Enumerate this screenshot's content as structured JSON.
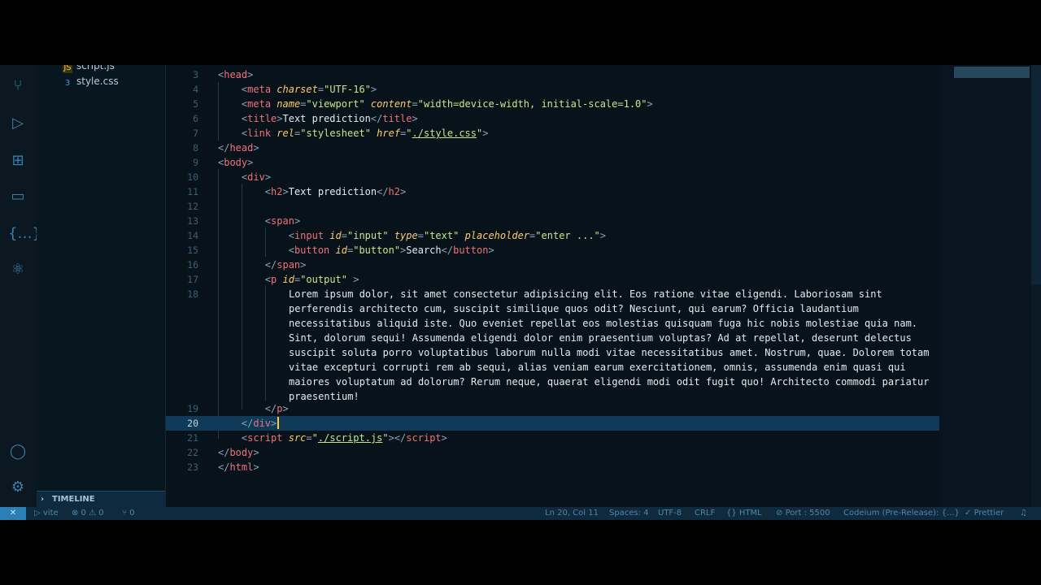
{
  "explorer": {
    "files": [
      {
        "name": "script.js",
        "icon": "js-file-icon",
        "color": "#e8c846"
      },
      {
        "name": "style.css",
        "icon": "css-file-icon",
        "color": "#3b9ad8"
      }
    ],
    "timeline_label": "TIMELINE"
  },
  "editor": {
    "current_line": "20",
    "lines": [
      {
        "n": "3"
      },
      {
        "n": "4",
        "value": "UTF-16"
      },
      {
        "n": "5",
        "name": "viewport",
        "content": "width=device-width, initial-scale=1.0"
      },
      {
        "n": "6",
        "text": "Text prediction"
      },
      {
        "n": "7",
        "rel": "stylesheet",
        "href": "./style.css"
      },
      {
        "n": "8"
      },
      {
        "n": "9"
      },
      {
        "n": "10"
      },
      {
        "n": "11",
        "text": "Text prediction"
      },
      {
        "n": "12"
      },
      {
        "n": "13"
      },
      {
        "n": "14",
        "id": "input",
        "type": "text",
        "placeholder": "enter ..."
      },
      {
        "n": "15",
        "id": "button",
        "text": "Search"
      },
      {
        "n": "16"
      },
      {
        "n": "17",
        "id": "output"
      },
      {
        "n": "18",
        "paragraph": [
          "Lorem ipsum dolor, sit amet consectetur adipisicing elit. Eos ratione vitae eligendi. Laboriosam sint",
          "perferendis architecto cum, suscipit similique quos odit? Nesciunt, qui earum? Officia laudantium",
          "necessitatibus aliquid iste. Quo eveniet repellat eos molestias quisquam fuga hic nobis molestiae quia nam.",
          "Sint, dolorum sequi! Assumenda eligendi dolor enim praesentium voluptas? Ad at repellat, deserunt delectus",
          "suscipit soluta porro voluptatibus laborum nulla modi vitae necessitatibus amet. Nostrum, quae. Dolorem totam",
          "vitae excepturi corrupti rem ab sequi, alias veniam earum exercitationem, omnis, assumenda enim quasi qui",
          "maiores voluptatum ad dolorum? Rerum neque, quaerat eligendi modi odit fugit quo! Architecto commodi pariatur",
          "praesentium!"
        ]
      },
      {
        "n": "19"
      },
      {
        "n": "20"
      },
      {
        "n": "21",
        "src": "./script.js"
      },
      {
        "n": "22"
      },
      {
        "n": "23"
      }
    ]
  },
  "statusbar": {
    "branch": "vite",
    "problems": "⊗ 0 ⚠ 0",
    "ports": "0",
    "position": "Ln 20, Col 11",
    "spaces": "Spaces: 4",
    "encoding": "UTF-8",
    "eol": "CRLF",
    "language": "HTML",
    "port": "Port : 5500",
    "ai": "Codeium (Pre-Release): {...}",
    "formatter": "Prettier"
  },
  "colors": {
    "tag": "#f07178",
    "attribute": "#ffcb6b",
    "string": "#c3e88d",
    "current_line": "#0f3a58",
    "status_accent": "#2a7fb4"
  }
}
